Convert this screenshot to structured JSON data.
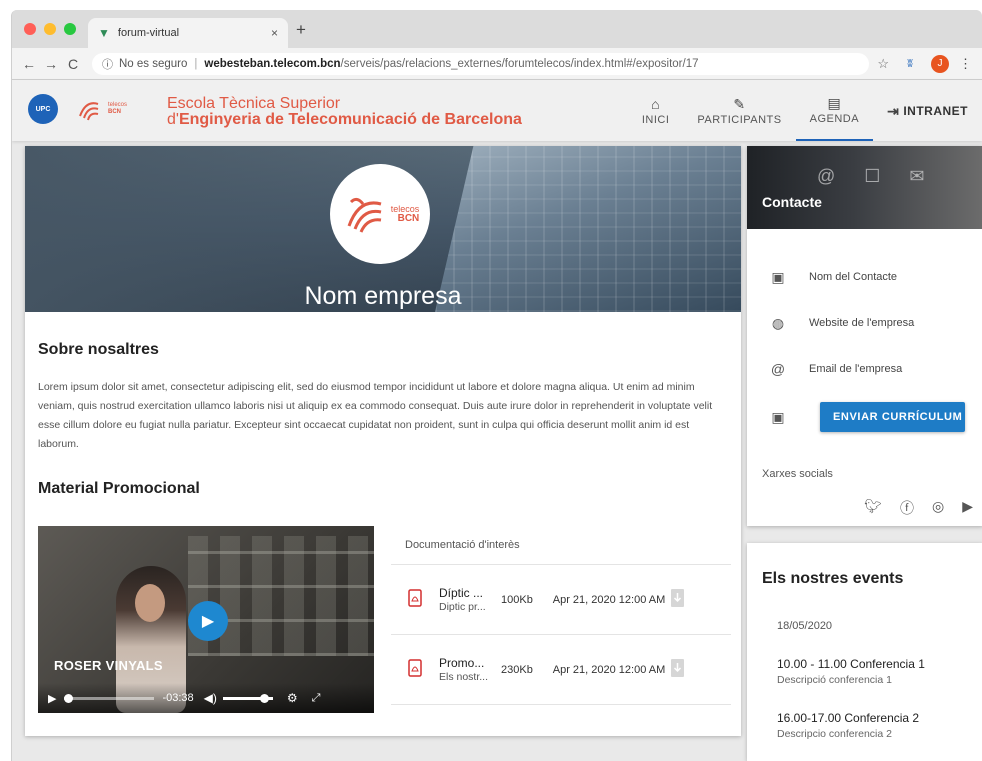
{
  "browser": {
    "tab_title": "forum-virtual",
    "tab_close": "×",
    "new_tab": "+",
    "back": "←",
    "forward": "→",
    "reload": "C",
    "security": "No es seguro",
    "url_host": "webesteban.telecom.bcn",
    "url_path": "/serveis/pas/relacions_externes/forumtelecos/index.html#/expositor/17",
    "profile_initial": "J"
  },
  "header": {
    "school_line1": "Escola Tècnica Superior",
    "school_line2_prefix": "d'",
    "school_line2_bold": "Enginyeria de Telecomunicació  de Barcelona",
    "upc_label": "UPC",
    "telecos_small": "telecos",
    "telecos_small2": "BCN",
    "nav": [
      {
        "label": "INICI",
        "icon": "home-icon"
      },
      {
        "label": "PARTICIPANTS",
        "icon": "handshake-icon"
      },
      {
        "label": "AGENDA",
        "icon": "calendar-icon"
      },
      {
        "label": "INTRANET",
        "icon": "login-icon"
      }
    ]
  },
  "company": {
    "name": "Nom empresa",
    "logo_text1": "telecos",
    "logo_text2": "BCN"
  },
  "about": {
    "title": "Sobre nosaltres",
    "text": "Lorem ipsum dolor sit amet, consectetur adipiscing elit, sed do eiusmod tempor incididunt ut labore et dolore magna aliqua. Ut enim ad minim veniam, quis nostrud exercitation ullamco laboris nisi ut aliquip ex ea commodo consequat. Duis aute irure dolor in reprehenderit in voluptate velit esse cillum dolore eu fugiat nulla pariatur. Excepteur sint occaecat cupidatat non proident, sunt in culpa qui officia deserunt mollit anim id est laborum."
  },
  "promo": {
    "title": "Material Promocional",
    "video": {
      "caption": "ROSER VINYALS",
      "time": "-03:38",
      "progress": 0.0,
      "volume": 0.9
    },
    "docs_header": "Documentació d'interès",
    "docs": [
      {
        "name": "Díptic ...",
        "desc": "Diptic pr...",
        "size": "100Kb",
        "date": "Apr 21, 2020 12:00 AM"
      },
      {
        "name": "Promo...",
        "desc": "Els nostr...",
        "size": "230Kb",
        "date": "Apr 21, 2020 12:00 AM"
      }
    ]
  },
  "contact": {
    "title": "Contacte",
    "contact_name": "Nom del Contacte",
    "website": "Website de l'empresa",
    "email": "Email de l'empresa",
    "cv_button": "ENVIAR CURRÍCULUM",
    "socials_label": "Xarxes socials",
    "socials": [
      "twitter-icon",
      "facebook-icon",
      "instagram-icon",
      "youtube-icon"
    ]
  },
  "events": {
    "title": "Els nostres events",
    "date": "18/05/2020",
    "items": [
      {
        "title": "10.00 - 11.00 Conferencia 1",
        "desc": "Descripció conferencia 1"
      },
      {
        "title": "16.00-17.00 Conferencia 2",
        "desc": "Descripcio conferencia 2"
      }
    ]
  },
  "colors": {
    "accent": "#1e7cc6",
    "brand_red": "#e05a45",
    "pdf_red": "#d32f2f"
  }
}
